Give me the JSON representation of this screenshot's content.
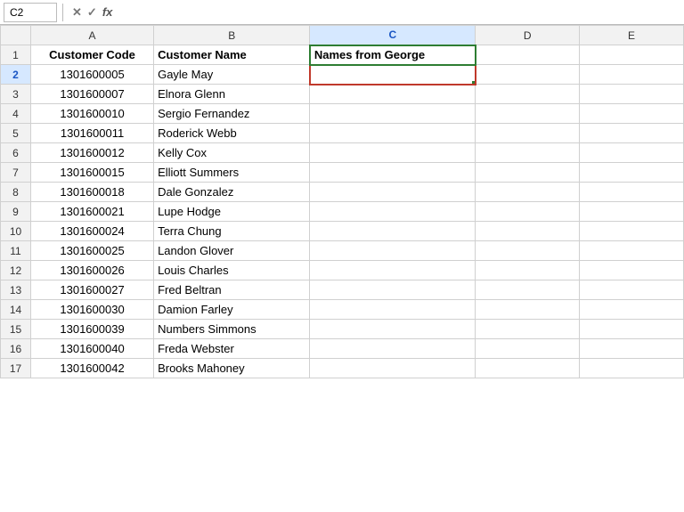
{
  "formula_bar": {
    "cell_ref": "C2",
    "formula_text": "",
    "cancel_icon": "✕",
    "confirm_icon": "✓",
    "fx_label": "fx"
  },
  "columns": {
    "headers": [
      "",
      "A",
      "B",
      "C",
      "D",
      "E"
    ],
    "col_a_label": "A",
    "col_b_label": "B",
    "col_c_label": "C",
    "col_d_label": "D",
    "col_e_label": "E"
  },
  "rows": [
    {
      "row_num": "1",
      "a": "Customer Code",
      "b": "Customer Name",
      "c": "Names from George",
      "d": "",
      "e": ""
    },
    {
      "row_num": "2",
      "a": "1301600005",
      "b": "Gayle May",
      "c": "",
      "d": "",
      "e": ""
    },
    {
      "row_num": "3",
      "a": "1301600007",
      "b": "Elnora Glenn",
      "c": "",
      "d": "",
      "e": ""
    },
    {
      "row_num": "4",
      "a": "1301600010",
      "b": "Sergio Fernandez",
      "c": "",
      "d": "",
      "e": ""
    },
    {
      "row_num": "5",
      "a": "1301600011",
      "b": "Roderick Webb",
      "c": "",
      "d": "",
      "e": ""
    },
    {
      "row_num": "6",
      "a": "1301600012",
      "b": "Kelly Cox",
      "c": "",
      "d": "",
      "e": ""
    },
    {
      "row_num": "7",
      "a": "1301600015",
      "b": "Elliott Summers",
      "c": "",
      "d": "",
      "e": ""
    },
    {
      "row_num": "8",
      "a": "1301600018",
      "b": "Dale Gonzalez",
      "c": "",
      "d": "",
      "e": ""
    },
    {
      "row_num": "9",
      "a": "1301600021",
      "b": "Lupe Hodge",
      "c": "",
      "d": "",
      "e": ""
    },
    {
      "row_num": "10",
      "a": "1301600024",
      "b": "Terra Chung",
      "c": "",
      "d": "",
      "e": ""
    },
    {
      "row_num": "11",
      "a": "1301600025",
      "b": "Landon Glover",
      "c": "",
      "d": "",
      "e": ""
    },
    {
      "row_num": "12",
      "a": "1301600026",
      "b": "Louis Charles",
      "c": "",
      "d": "",
      "e": ""
    },
    {
      "row_num": "13",
      "a": "1301600027",
      "b": "Fred Beltran",
      "c": "",
      "d": "",
      "e": ""
    },
    {
      "row_num": "14",
      "a": "1301600030",
      "b": "Damion Farley",
      "c": "",
      "d": "",
      "e": ""
    },
    {
      "row_num": "15",
      "a": "1301600039",
      "b": "Numbers Simmons",
      "c": "",
      "d": "",
      "e": ""
    },
    {
      "row_num": "16",
      "a": "1301600040",
      "b": "Freda Webster",
      "c": "",
      "d": "",
      "e": ""
    },
    {
      "row_num": "17",
      "a": "1301600042",
      "b": "Brooks Mahoney",
      "c": "",
      "d": "",
      "e": ""
    }
  ]
}
